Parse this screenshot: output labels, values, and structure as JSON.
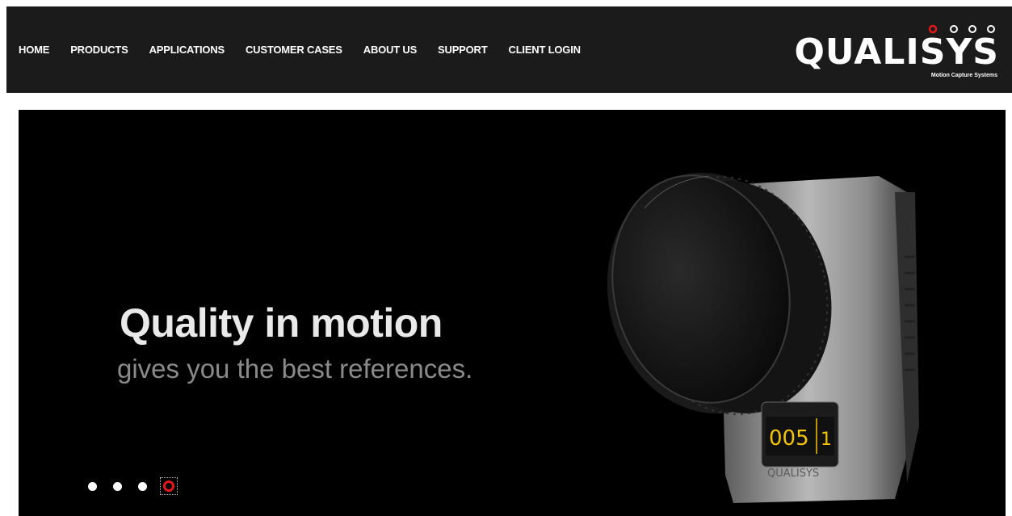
{
  "nav": {
    "items": [
      {
        "label": "HOME"
      },
      {
        "label": "PRODUCTS"
      },
      {
        "label": "APPLICATIONS"
      },
      {
        "label": "CUSTOMER CASES"
      },
      {
        "label": "ABOUT US"
      },
      {
        "label": "SUPPORT"
      },
      {
        "label": "CLIENT LOGIN"
      }
    ]
  },
  "logo": {
    "word": "QUALISYS",
    "tagline": "Motion Capture Systems",
    "accent_color": "#e31a1a"
  },
  "hero": {
    "title": "Quality in motion",
    "subtitle": "gives you the best references.",
    "camera_display": {
      "left": "005",
      "right": "1"
    },
    "camera_brand": "QUALISYS"
  },
  "slider": {
    "slide_count": 4,
    "active_index": 4
  },
  "colors": {
    "topbar": "#1b1b1b",
    "hero_bg": "#000000",
    "active_dot": "#e31a1a",
    "display_text": "#f5c400"
  }
}
